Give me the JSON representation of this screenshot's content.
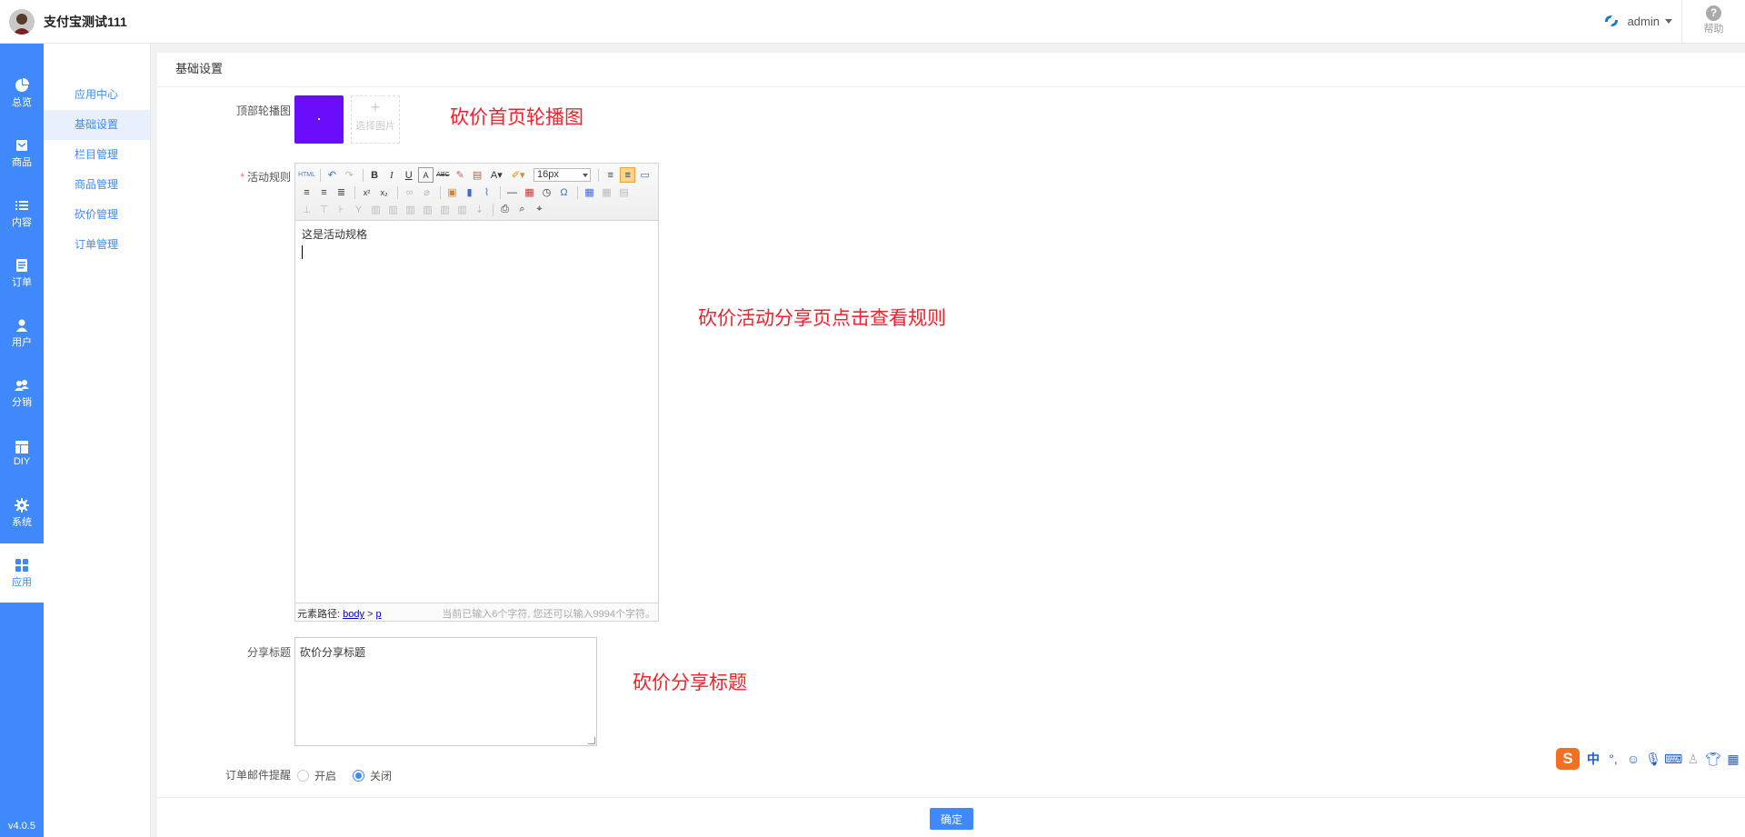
{
  "header": {
    "app_name": "支付宝测试111",
    "user_name": "admin",
    "help_label": "帮助"
  },
  "left_nav": {
    "items": [
      {
        "label": "总览",
        "icon": "pie-chart-icon"
      },
      {
        "label": "商品",
        "icon": "inbox-icon"
      },
      {
        "label": "内容",
        "icon": "list-icon"
      },
      {
        "label": "订单",
        "icon": "document-icon"
      },
      {
        "label": "用户",
        "icon": "user-icon"
      },
      {
        "label": "分销",
        "icon": "users-icon"
      },
      {
        "label": "DIY",
        "icon": "layout-icon"
      },
      {
        "label": "系统",
        "icon": "gear-icon"
      },
      {
        "label": "应用",
        "icon": "grid-icon"
      }
    ],
    "active": "应用",
    "version": "v4.0.5"
  },
  "sub_nav": {
    "items": [
      "应用中心",
      "基础设置",
      "栏目管理",
      "商品管理",
      "砍价管理",
      "订单管理"
    ],
    "active": "基础设置"
  },
  "main": {
    "title": "基础设置",
    "banner_label": "顶部轮播图",
    "pick_image_label": "选择图片",
    "banner_note": "砍价首页轮播图",
    "rules_label": "活动规则",
    "rules_note": "砍价活动分享页点击查看规则",
    "editor": {
      "font_size": "16px",
      "content": "这是活动规格",
      "path_label": "元素路径:",
      "path_body": "body",
      "path_sep": ">",
      "path_p": "p",
      "char_count": "当前已输入6个字符, 您还可以输入9994个字符。"
    },
    "share_title_label": "分享标题",
    "share_title_value": "砍价分享标题",
    "share_title_note": "砍价分享标题",
    "email_label": "订单邮件提醒",
    "email_options": [
      "开启",
      "关闭"
    ],
    "email_selected": "关闭",
    "confirm_label": "确定"
  },
  "ime": {
    "logo": "S",
    "mode": "中"
  },
  "colors": {
    "primary": "#3f89fc",
    "annotation": "#f5222d",
    "banner_thumb": "#6a0dfa"
  }
}
